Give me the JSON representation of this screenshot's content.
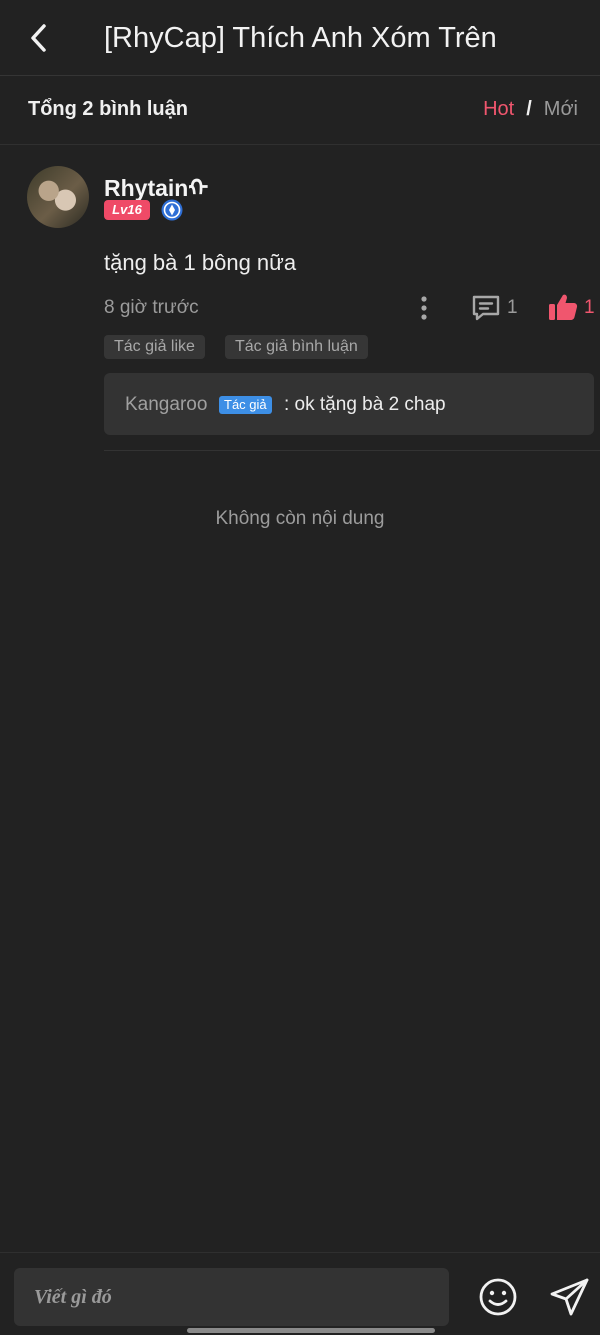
{
  "header": {
    "title": "[RhyCap] Thích Anh Xóm Trên",
    "back_icon": "chevron-left-icon"
  },
  "subbar": {
    "total": "Tổng 2 bình luận",
    "sort_hot": "Hot",
    "sort_sep": "/",
    "sort_new": "Mới",
    "hot_color": "#f0566e"
  },
  "comment": {
    "username": "Rhytainᡣ",
    "level": "Lv16",
    "text": "tặng bà 1 bông nữa",
    "time": "8 giờ trước",
    "reply_count": "1",
    "like_count": "1",
    "tags": [
      "Tác giả like",
      "Tác giả bình luận"
    ],
    "reply": {
      "author": "Kangaroo",
      "badge": "Tác giả",
      "text": ": ok tặng bà 2 chap"
    }
  },
  "footer_note": "Không còn nội dung",
  "input": {
    "placeholder": "Viết gì đó"
  },
  "colors": {
    "background": "#222222",
    "accent": "#f0566e",
    "badge_blue": "#3d8fe6"
  }
}
